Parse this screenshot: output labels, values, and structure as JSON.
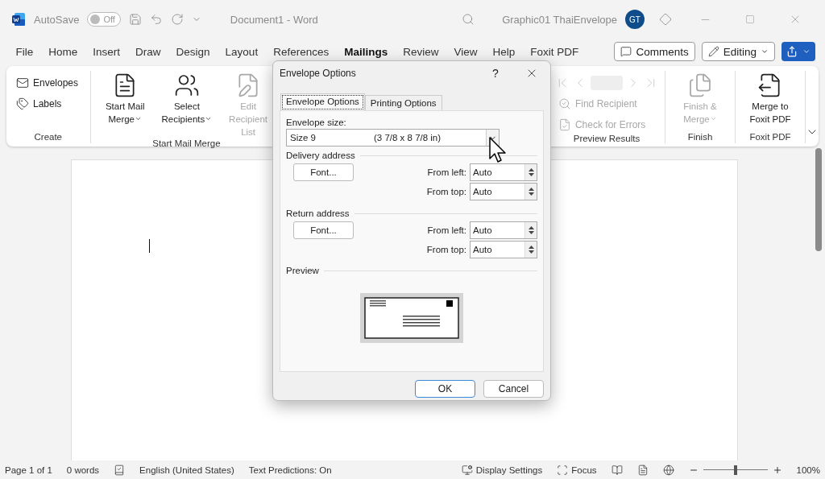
{
  "title_bar": {
    "autosave_label": "AutoSave",
    "autosave": {
      "label": "Off",
      "on": false
    },
    "document_title": "Document1  -  Word",
    "account_name": "Graphic01 ThaiEnvelope",
    "avatar": "GT"
  },
  "menu_tabs": [
    {
      "label": "File",
      "selected": false
    },
    {
      "label": "Home",
      "selected": false
    },
    {
      "label": "Insert",
      "selected": false
    },
    {
      "label": "Draw",
      "selected": false
    },
    {
      "label": "Design",
      "selected": false
    },
    {
      "label": "Layout",
      "selected": false
    },
    {
      "label": "References",
      "selected": false
    },
    {
      "label": "Mailings",
      "selected": true
    },
    {
      "label": "Review",
      "selected": false
    },
    {
      "label": "View",
      "selected": false
    },
    {
      "label": "Help",
      "selected": false
    },
    {
      "label": "Foxit PDF",
      "selected": false
    }
  ],
  "actions": {
    "comments": "Comments",
    "editing": "Editing"
  },
  "ribbon": {
    "groups": [
      {
        "label": "Create",
        "items": [
          {
            "kind": "small",
            "label": "Envelopes",
            "disabled": false
          },
          {
            "kind": "small",
            "label": "Labels",
            "disabled": false
          }
        ]
      },
      {
        "label": "Start Mail Merge",
        "items": [
          {
            "kind": "large",
            "label": "Start Mail Merge",
            "dropdown": true,
            "disabled": false
          },
          {
            "kind": "large",
            "label": "Select Recipients",
            "dropdown": true,
            "disabled": false
          },
          {
            "kind": "large",
            "label": "Edit Recipient List",
            "dropdown": false,
            "disabled": true
          }
        ]
      },
      {
        "label": "Preview Results",
        "items": [
          {
            "kind": "nav",
            "disabled": true
          },
          {
            "kind": "small",
            "label": "Find Recipient",
            "disabled": true
          },
          {
            "kind": "small",
            "label": "Check for Errors",
            "disabled": true
          }
        ]
      },
      {
        "label": "Finish",
        "items": [
          {
            "kind": "large",
            "label": "Finish & Merge",
            "dropdown": true,
            "disabled": true
          }
        ]
      },
      {
        "label": "Foxit PDF",
        "items": [
          {
            "kind": "large",
            "label": "Merge to Foxit PDF",
            "dropdown": false,
            "disabled": false
          }
        ]
      }
    ]
  },
  "dialog": {
    "title": "Envelope Options",
    "help": "?",
    "tabs": [
      {
        "label": "Envelope Options",
        "selected": true
      },
      {
        "label": "Printing Options",
        "selected": false
      }
    ],
    "size_label": "Envelope size:",
    "size_value": "Size 9",
    "size_dims": "(3 7/8 x 8 7/8 in)",
    "sections": [
      {
        "title": "Delivery address",
        "font_button": "Font...",
        "fields": [
          {
            "label": "From left:",
            "value": "Auto"
          },
          {
            "label": "From top:",
            "value": "Auto"
          }
        ]
      },
      {
        "title": "Return address",
        "font_button": "Font...",
        "fields": [
          {
            "label": "From left:",
            "value": "Auto"
          },
          {
            "label": "From top:",
            "value": "Auto"
          }
        ]
      }
    ],
    "preview_label": "Preview",
    "buttons": [
      {
        "label": "OK",
        "default": true
      },
      {
        "label": "Cancel",
        "default": false
      }
    ]
  },
  "status_bar": {
    "left": [
      "Page 1 of 1",
      "0 words"
    ],
    "language": "English (United States)",
    "predictions": "Text Predictions: On",
    "display_settings": "Display Settings",
    "focus": "Focus",
    "zoom": {
      "level": 0.5,
      "reading": "100%"
    }
  }
}
